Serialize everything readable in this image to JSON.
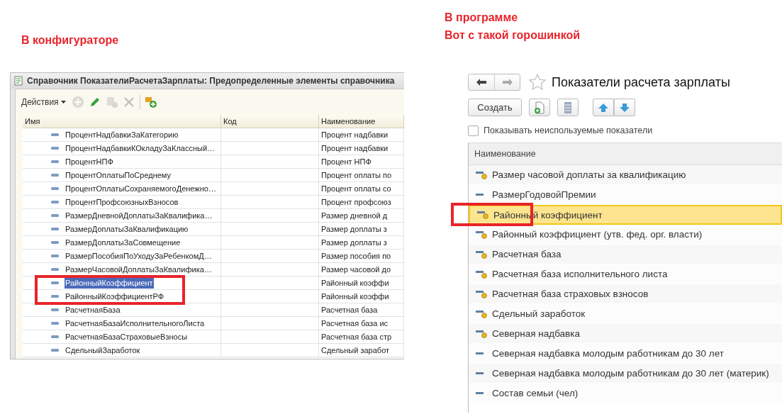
{
  "left": {
    "caption": "В конфигураторе",
    "window": {
      "title": "Справочник ПоказателиРасчетаЗарплаты: Предопределенные элементы справочника",
      "actions": "Действия",
      "tools": [
        {
          "kind": "add",
          "disabled": true
        },
        {
          "kind": "edit",
          "disabled": false
        },
        {
          "kind": "copy",
          "disabled": true
        },
        {
          "kind": "delete",
          "disabled": true
        },
        {
          "kind": "add-group",
          "disabled": false
        }
      ],
      "columns": [
        "Имя",
        "Код",
        "Наименование"
      ],
      "rows": [
        {
          "name": "ПроцентНадбавкиЗаКатегорию",
          "title": "Процент надбавки",
          "selected": false
        },
        {
          "name": "ПроцентНадбавкиКОкладуЗаКлассный…",
          "title": "Процент надбавки",
          "selected": false
        },
        {
          "name": "ПроцентНПФ",
          "title": "Процент НПФ",
          "selected": false
        },
        {
          "name": "ПроцентОплатыПоСреднему",
          "title": "Процент оплаты по",
          "selected": false
        },
        {
          "name": "ПроцентОплатыСохраняемогоДенежно…",
          "title": "Процент оплаты со",
          "selected": false
        },
        {
          "name": "ПроцентПрофсоюзныхВзносов",
          "title": "Процент профсоюз",
          "selected": false
        },
        {
          "name": "РазмерДневнойДоплатыЗаКвалифика…",
          "title": "Размер дневной д",
          "selected": false
        },
        {
          "name": "РазмерДоплатыЗаКвалификацию",
          "title": "Размер доплаты з",
          "selected": false
        },
        {
          "name": "РазмерДоплатыЗаСовмещение",
          "title": "Размер доплаты з",
          "selected": false
        },
        {
          "name": "РазмерПособияПоУходуЗаРебенкомД…",
          "title": "Размер пособия по",
          "selected": false
        },
        {
          "name": "РазмерЧасовойДоплатыЗаКвалифика…",
          "title": "Размер часовой до",
          "selected": false
        },
        {
          "name": "РайонныйКоэффициент",
          "title": "Районный коэффи",
          "selected": true
        },
        {
          "name": "РайонныйКоэффициентРФ",
          "title": "Районный коэффи",
          "selected": false
        },
        {
          "name": "РасчетнаяБаза",
          "title": "Расчетная база",
          "selected": false
        },
        {
          "name": "РасчетнаяБазаИсполнительногоЛиста",
          "title": "Расчетная база ис",
          "selected": false
        },
        {
          "name": "РасчетнаяБазаСтраховыеВзносы",
          "title": "Расчетная база стр",
          "selected": false
        },
        {
          "name": "СдельныйЗаработок",
          "title": "Сдельный заработ",
          "selected": false
        }
      ]
    }
  },
  "right": {
    "captions": [
      "В программе",
      "Вот с такой горошинкой"
    ],
    "nav": [
      {
        "kind": "back",
        "disabled": false
      },
      {
        "kind": "forward",
        "disabled": true
      }
    ],
    "favorite": false,
    "title": "Показатели расчета зарплаты",
    "create": "Создать",
    "tools": [
      {
        "kind": "new-document"
      },
      {
        "kind": "list"
      },
      {
        "kind": "up"
      },
      {
        "kind": "down"
      }
    ],
    "show_unused": {
      "label": "Показывать неиспользуемые показатели",
      "checked": false
    },
    "column": "Наименование",
    "rows": [
      {
        "text": "Размер часовой доплаты за квалификацию",
        "kind": "dotted",
        "selected": false
      },
      {
        "text": "РазмерГодовойПремии",
        "kind": "plain",
        "selected": false
      },
      {
        "text": "Районный коэффициент",
        "kind": "dotted",
        "selected": true
      },
      {
        "text": "Районный коэффициент (утв. фед. орг. власти)",
        "kind": "dotted",
        "selected": false
      },
      {
        "text": "Расчетная база",
        "kind": "dotted",
        "selected": false
      },
      {
        "text": "Расчетная база исполнительного листа",
        "kind": "dotted",
        "selected": false
      },
      {
        "text": "Расчетная база страховых взносов",
        "kind": "dotted",
        "selected": false
      },
      {
        "text": "Сдельный заработок",
        "kind": "dotted",
        "selected": false
      },
      {
        "text": "Северная надбавка",
        "kind": "dotted",
        "selected": false
      },
      {
        "text": "Северная надбавка молодым работникам до 30 лет",
        "kind": "plain",
        "selected": false
      },
      {
        "text": "Северная надбавка молодым работникам до 30 лет (материк)",
        "kind": "plain",
        "selected": false
      },
      {
        "text": "Состав семьи (чел)",
        "kind": "plain",
        "selected": false
      }
    ]
  }
}
